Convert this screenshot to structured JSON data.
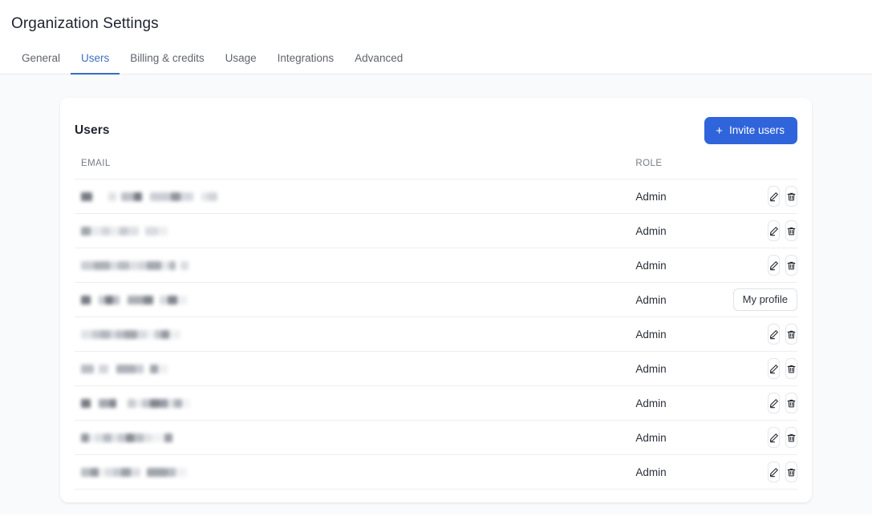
{
  "page": {
    "title": "Organization Settings"
  },
  "tabs": [
    {
      "label": "General",
      "active": false
    },
    {
      "label": "Users",
      "active": true
    },
    {
      "label": "Billing & credits",
      "active": false
    },
    {
      "label": "Usage",
      "active": false
    },
    {
      "label": "Integrations",
      "active": false
    },
    {
      "label": "Advanced",
      "active": false
    }
  ],
  "card": {
    "title": "Users",
    "invite_button": {
      "label": "Invite users",
      "icon": "plus-icon"
    }
  },
  "table": {
    "columns": [
      "EMAIL",
      "ROLE",
      ""
    ],
    "rows": [
      {
        "email": "[redacted]",
        "email_redacted": true,
        "role": "Admin",
        "actions": "edit-delete"
      },
      {
        "email": "[redacted]",
        "email_redacted": true,
        "role": "Admin",
        "actions": "edit-delete"
      },
      {
        "email": "[redacted]",
        "email_redacted": true,
        "role": "Admin",
        "actions": "edit-delete"
      },
      {
        "email": "[redacted]",
        "email_redacted": true,
        "role": "Admin",
        "actions": "my-profile"
      },
      {
        "email": "[redacted]",
        "email_redacted": true,
        "role": "Admin",
        "actions": "edit-delete"
      },
      {
        "email": "[redacted]",
        "email_redacted": true,
        "role": "Admin",
        "actions": "edit-delete"
      },
      {
        "email": "[redacted]",
        "email_redacted": true,
        "role": "Admin",
        "actions": "edit-delete"
      },
      {
        "email": "[redacted]",
        "email_redacted": true,
        "role": "Admin",
        "actions": "edit-delete"
      },
      {
        "email": "[redacted]",
        "email_redacted": true,
        "role": "Admin",
        "actions": "edit-delete"
      }
    ],
    "action_labels": {
      "edit": "edit-icon",
      "delete": "delete-icon",
      "my_profile": "My profile"
    }
  },
  "colors": {
    "accent": "#2F64DB",
    "active_tab": "#3F6EC4",
    "page_bg": "#F9FAFB",
    "card_bg": "#FFFFFF",
    "divider": "#EDEEF1",
    "muted_text": "#767B85",
    "body_text": "#1F2430"
  },
  "redaction_patterns": [
    [
      [
        14,
        "#6f747c"
      ],
      [
        20,
        "#ffffff"
      ],
      [
        10,
        "#dfe1e5"
      ],
      [
        6,
        "#ffffff"
      ],
      [
        16,
        "#b9bdc4"
      ],
      [
        10,
        "#6f747c"
      ],
      [
        10,
        "#ffffff"
      ],
      [
        26,
        "#c9ccd2"
      ],
      [
        12,
        "#8b9099"
      ],
      [
        16,
        "#d4d7dc"
      ],
      [
        10,
        "#ffffff"
      ],
      [
        8,
        "#e3e5e9"
      ],
      [
        12,
        "#cfd2d7"
      ]
    ],
    [
      [
        12,
        "#9ba0a8"
      ],
      [
        14,
        "#e7e9ec"
      ],
      [
        10,
        "#d0d3d8"
      ],
      [
        12,
        "#e9ebee"
      ],
      [
        10,
        "#c3c7cd"
      ],
      [
        14,
        "#dcdee2"
      ],
      [
        8,
        "#ffffff"
      ],
      [
        16,
        "#d7dade"
      ],
      [
        12,
        "#ececef"
      ]
    ],
    [
      [
        16,
        "#c8cbd1"
      ],
      [
        20,
        "#a9aeb5"
      ],
      [
        10,
        "#d8dbdf"
      ],
      [
        14,
        "#b4b9c0"
      ],
      [
        12,
        "#dcdee2"
      ],
      [
        10,
        "#cfd2d7"
      ],
      [
        18,
        "#9fa4ac"
      ],
      [
        10,
        "#e4e6e9"
      ],
      [
        8,
        "#b0b5bc"
      ],
      [
        6,
        "#ffffff"
      ],
      [
        10,
        "#d9dce0"
      ]
    ],
    [
      [
        12,
        "#6f747c"
      ],
      [
        10,
        "#ffffff"
      ],
      [
        8,
        "#c6c9cf"
      ],
      [
        10,
        "#6f747c"
      ],
      [
        8,
        "#b8bcc3"
      ],
      [
        10,
        "#ffffff"
      ],
      [
        20,
        "#a6abb2"
      ],
      [
        12,
        "#7b8088"
      ],
      [
        8,
        "#ffffff"
      ],
      [
        10,
        "#d6d9dd"
      ],
      [
        12,
        "#7b8088"
      ],
      [
        12,
        "#eceef0"
      ]
    ],
    [
      [
        14,
        "#dfe1e5"
      ],
      [
        10,
        "#c3c7cd"
      ],
      [
        12,
        "#aeb3ba"
      ],
      [
        8,
        "#d3d6db"
      ],
      [
        10,
        "#b9bdc4"
      ],
      [
        16,
        "#9ea3ab"
      ],
      [
        12,
        "#d7dade"
      ],
      [
        10,
        "#f0f1f3"
      ],
      [
        8,
        "#c0c4ca"
      ],
      [
        10,
        "#8f949c"
      ],
      [
        14,
        "#eceef0"
      ]
    ],
    [
      [
        16,
        "#b5b9c0"
      ],
      [
        6,
        "#ffffff"
      ],
      [
        12,
        "#d0d3d8"
      ],
      [
        10,
        "#ffffff"
      ],
      [
        24,
        "#a8adb4"
      ],
      [
        10,
        "#c6c9cf"
      ],
      [
        8,
        "#ffffff"
      ],
      [
        10,
        "#9ba0a8"
      ],
      [
        12,
        "#eceef0"
      ]
    ],
    [
      [
        12,
        "#6f747c"
      ],
      [
        10,
        "#ffffff"
      ],
      [
        14,
        "#a0a5ad"
      ],
      [
        8,
        "#7b8088"
      ],
      [
        14,
        "#ffffff"
      ],
      [
        10,
        "#c6c9cf"
      ],
      [
        8,
        "#ebedef"
      ],
      [
        10,
        "#c0c4ca"
      ],
      [
        12,
        "#7b8088"
      ],
      [
        10,
        "#9096a0"
      ],
      [
        8,
        "#dde0e3"
      ],
      [
        10,
        "#a8adb4"
      ],
      [
        10,
        "#f2f3f5"
      ]
    ],
    [
      [
        10,
        "#8f949c"
      ],
      [
        8,
        "#eceef0"
      ],
      [
        10,
        "#dbdde1"
      ],
      [
        10,
        "#b1b6bd"
      ],
      [
        8,
        "#e2e4e7"
      ],
      [
        10,
        "#c2c6cc"
      ],
      [
        10,
        "#82878f"
      ],
      [
        12,
        "#b7bbc2"
      ],
      [
        10,
        "#dfe1e5"
      ],
      [
        16,
        "#f0f1f3"
      ],
      [
        10,
        "#93989f"
      ]
    ],
    [
      [
        12,
        "#b7bbc2"
      ],
      [
        10,
        "#8f949c"
      ],
      [
        8,
        "#f0f1f3"
      ],
      [
        10,
        "#d9dce0"
      ],
      [
        10,
        "#c4c8ce"
      ],
      [
        12,
        "#969ba3"
      ],
      [
        12,
        "#dadce0"
      ],
      [
        8,
        "#ffffff"
      ],
      [
        26,
        "#9aa0a7"
      ],
      [
        10,
        "#b3b8bf"
      ],
      [
        14,
        "#eff0f2"
      ]
    ]
  ]
}
